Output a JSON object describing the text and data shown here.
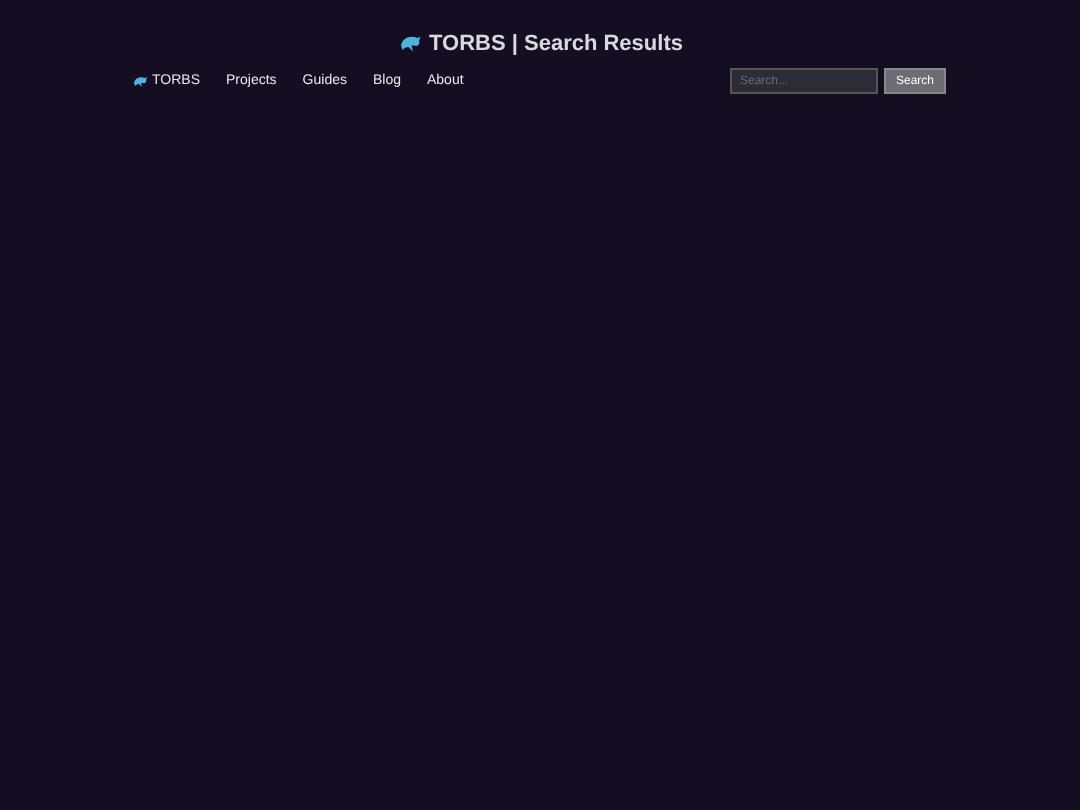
{
  "page_title": "TORBS | Search Results",
  "nav": {
    "brand": "TORBS",
    "links": [
      {
        "label": "Projects"
      },
      {
        "label": "Guides"
      },
      {
        "label": "Blog"
      },
      {
        "label": "About"
      }
    ]
  },
  "search": {
    "placeholder": "Search...",
    "button": "Search"
  }
}
